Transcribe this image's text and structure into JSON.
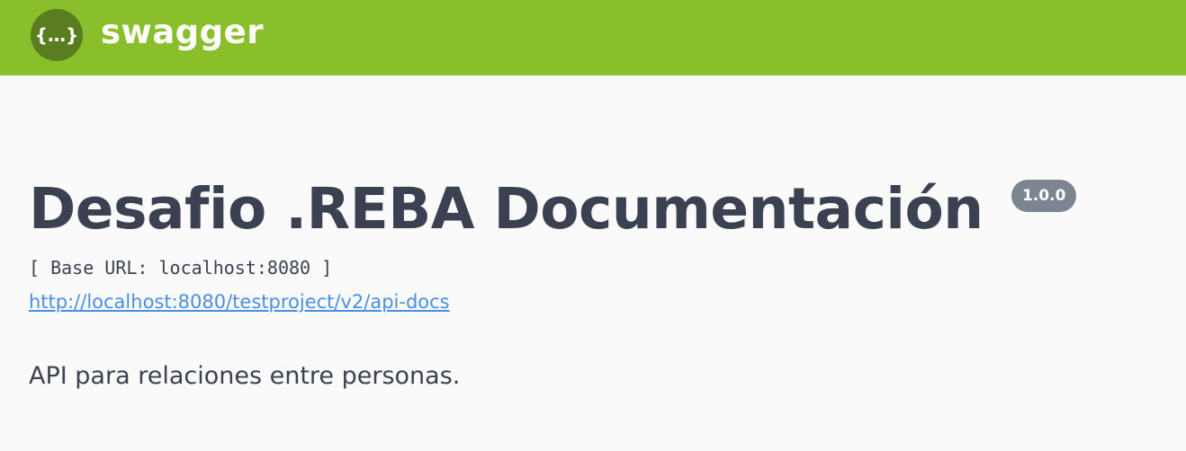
{
  "header": {
    "brand_name": "swagger",
    "logo_icon": "swagger-braces-icon",
    "logo_glyph": "{…}",
    "bar_color": "#89bf2a"
  },
  "info": {
    "title": "Desafio .REBA Documentación",
    "version": "1.0.0",
    "base_url": "[ Base URL: localhost:8080 ]",
    "api_docs_link": "http://localhost:8080/testproject/v2/api-docs",
    "description": "API para relaciones entre personas."
  },
  "colors": {
    "text": "#3b4151",
    "link": "#4990e2",
    "badge": "#7d8492",
    "background": "#fafafa"
  }
}
